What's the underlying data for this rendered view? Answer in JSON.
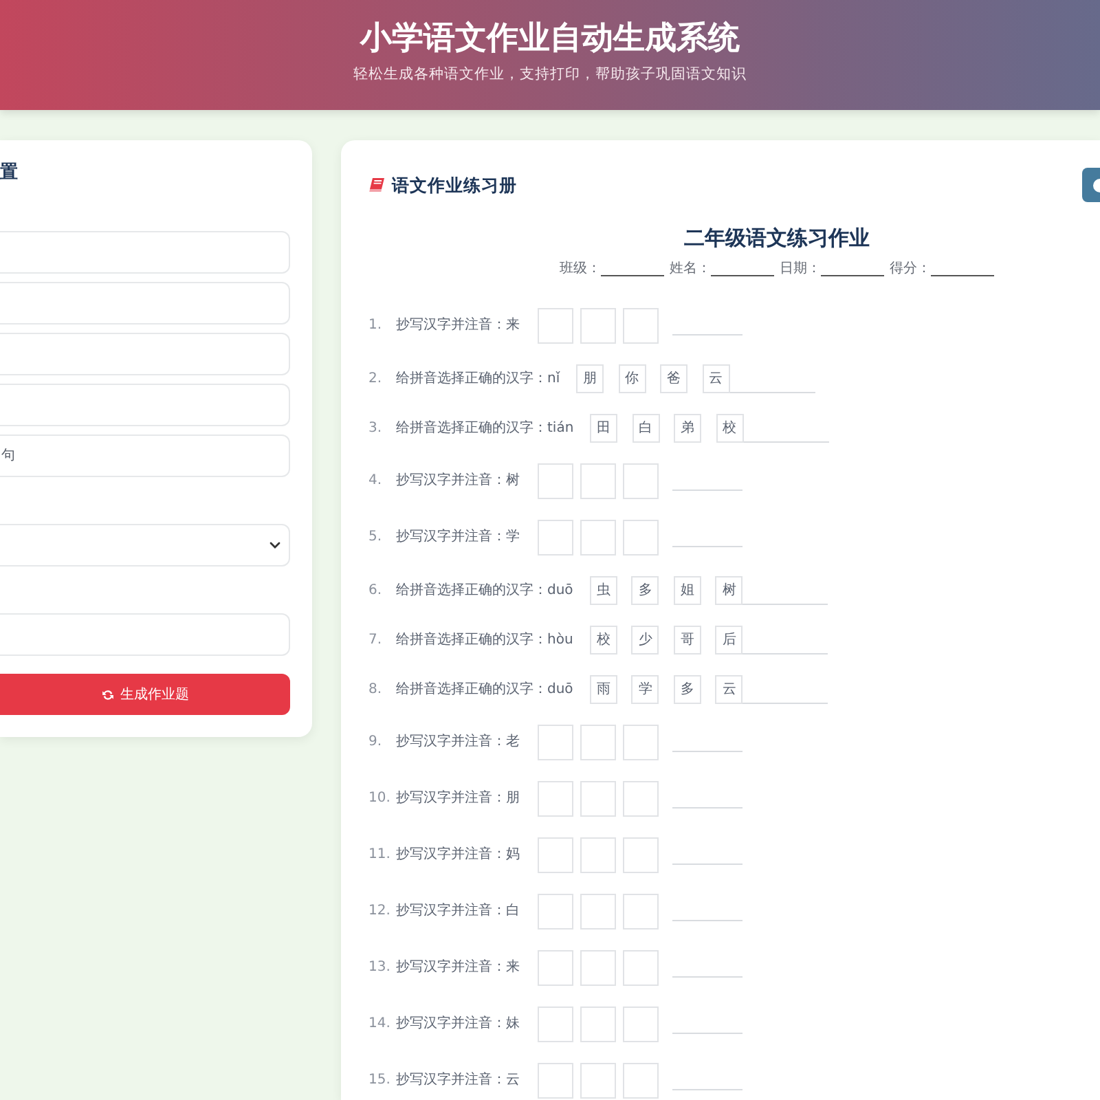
{
  "header": {
    "title": "小学语文作业自动生成系统",
    "subtitle": "轻松生成各种语文作业，支持打印，帮助孩子巩固语文知识"
  },
  "settings": {
    "title": "置",
    "fields": [
      {
        "kind": "input"
      },
      {
        "kind": "input"
      },
      {
        "kind": "input"
      },
      {
        "kind": "input"
      },
      {
        "kind": "input",
        "value": "句"
      },
      {
        "kind": "select"
      },
      {
        "kind": "input"
      }
    ],
    "button": {
      "label": "生成作业题"
    }
  },
  "worksheet": {
    "panel_title": "语文作业练习册",
    "sheet_title": "二年级语文练习作业",
    "info_fields": [
      {
        "label": "班级："
      },
      {
        "label": "姓名："
      },
      {
        "label": "日期："
      },
      {
        "label": "得分："
      }
    ],
    "questions": [
      {
        "number": "1.",
        "kind": "copy",
        "text": "抄写汉字并注音：来"
      },
      {
        "number": "2.",
        "kind": "choose",
        "text": "给拼音选择正确的汉字：nǐ",
        "options": [
          "朋",
          "你",
          "爸",
          "云"
        ]
      },
      {
        "number": "3.",
        "kind": "choose",
        "text": "给拼音选择正确的汉字：tián",
        "options": [
          "田",
          "白",
          "弟",
          "校"
        ]
      },
      {
        "number": "4.",
        "kind": "copy",
        "text": "抄写汉字并注音：树"
      },
      {
        "number": "5.",
        "kind": "copy",
        "text": "抄写汉字并注音：学"
      },
      {
        "number": "6.",
        "kind": "choose",
        "text": "给拼音选择正确的汉字：duō",
        "options": [
          "虫",
          "多",
          "姐",
          "树"
        ]
      },
      {
        "number": "7.",
        "kind": "choose",
        "text": "给拼音选择正确的汉字：hòu",
        "options": [
          "校",
          "少",
          "哥",
          "后"
        ]
      },
      {
        "number": "8.",
        "kind": "choose",
        "text": "给拼音选择正确的汉字：duō",
        "options": [
          "雨",
          "学",
          "多",
          "云"
        ]
      },
      {
        "number": "9.",
        "kind": "copy",
        "text": "抄写汉字并注音：老"
      },
      {
        "number": "10.",
        "kind": "copy",
        "text": "抄写汉字并注音：朋"
      },
      {
        "number": "11.",
        "kind": "copy",
        "text": "抄写汉字并注音：妈"
      },
      {
        "number": "12.",
        "kind": "copy",
        "text": "抄写汉字并注音：白"
      },
      {
        "number": "13.",
        "kind": "copy",
        "text": "抄写汉字并注音：来"
      },
      {
        "number": "14.",
        "kind": "copy",
        "text": "抄写汉字并注音：妹"
      },
      {
        "number": "15.",
        "kind": "copy",
        "text": "抄写汉字并注音：云"
      }
    ]
  }
}
